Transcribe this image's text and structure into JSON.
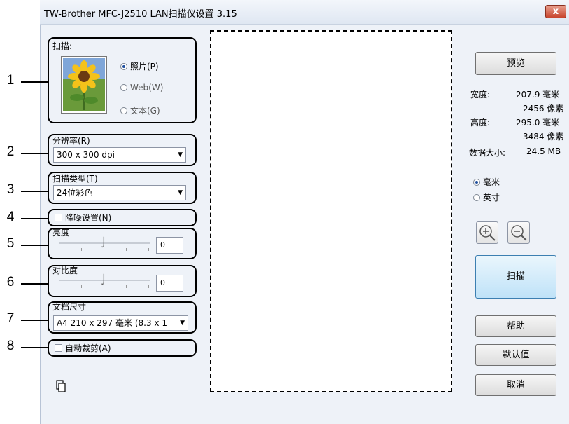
{
  "window": {
    "title": "TW-Brother MFC-J2510 LAN扫描仪设置 3.15",
    "close_label": "x"
  },
  "callouts": [
    "1",
    "2",
    "3",
    "4",
    "5",
    "6",
    "7",
    "8"
  ],
  "scan": {
    "label": "扫描:",
    "options": [
      {
        "label": "照片(P)",
        "selected": true
      },
      {
        "label": "Web(W)",
        "selected": false
      },
      {
        "label": "文本(G)",
        "selected": false
      }
    ]
  },
  "resolution": {
    "label": "分辨率(R)",
    "value": "300 x 300 dpi"
  },
  "scan_type": {
    "label": "扫描类型(T)",
    "value": "24位彩色"
  },
  "noise_reduction": {
    "label": "降噪设置(N)",
    "checked": false
  },
  "brightness": {
    "label": "亮度",
    "value": "0"
  },
  "contrast": {
    "label": "对比度",
    "value": "0"
  },
  "document_size": {
    "label": "文档尺寸",
    "value": "A4 210 x 297 毫米 (8.3 x 1"
  },
  "auto_crop": {
    "label": "自动裁剪(A)",
    "checked": false
  },
  "right_panel": {
    "preview_button": "预览",
    "width_label": "宽度:",
    "width_mm": "207.9 毫米",
    "width_px": "2456 像素",
    "height_label": "高度:",
    "height_mm": "295.0 毫米",
    "height_px": "3484 像素",
    "data_size_label": "数据大小:",
    "data_size_value": "24.5 MB",
    "units": [
      {
        "label": "毫米",
        "selected": true
      },
      {
        "label": "英寸",
        "selected": false
      }
    ],
    "zoom_in_icon": "zoom-in-icon",
    "zoom_out_icon": "zoom-out-icon",
    "scan_button": "扫描",
    "help_button": "帮助",
    "default_button": "默认值",
    "cancel_button": "取消"
  }
}
